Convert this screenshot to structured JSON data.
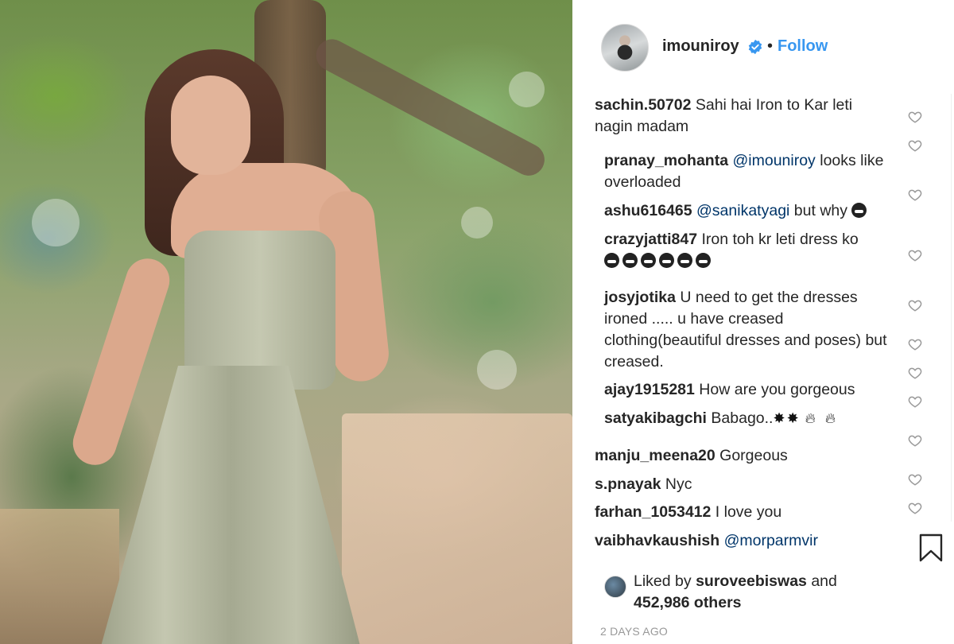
{
  "post": {
    "image_alt": "",
    "author": "imouniroy",
    "follow_label": "Follow",
    "separator": "•"
  },
  "comments": [
    {
      "user": "sachin.50702",
      "text": "Sahi hai Iron to Kar leti nagin madam"
    },
    {
      "user": "pranay_mohanta",
      "mention": "@imouniroy",
      "text": " looks like overloaded"
    },
    {
      "user": "ashu616465",
      "mention": "@sanikatyagi",
      "text": " but why"
    },
    {
      "user": "crazyjatti847",
      "text": "Iron toh kr leti dress ko"
    },
    {
      "user": "josyjotika",
      "text": "U need to get the dresses ironed ..... u have creased clothing(beautiful dresses and poses) but creased."
    },
    {
      "user": "ajay1915281",
      "text": "How are you gorgeous"
    },
    {
      "user": "satyakibagchi",
      "text": "Babago.."
    },
    {
      "user": "manju_meena20",
      "text": "Gorgeous"
    },
    {
      "user": "s.pnayak",
      "text": "Nyc"
    },
    {
      "user": "farhan_1053412",
      "text": "I love you"
    },
    {
      "user": "vaibhavkaushish",
      "mention": "@morparmvir",
      "text": ""
    }
  ],
  "likes": {
    "prefix": "Liked by",
    "user": "suroveebiswas",
    "and": "and",
    "count": "452,986 others"
  },
  "timestamp": "2 DAYS AGO",
  "icons": {
    "verified": "verified-badge-icon",
    "heart": "heart-outline-icon",
    "bookmark": "bookmark-outline-icon"
  },
  "colors": {
    "link": "#3897f0",
    "mention": "#003569",
    "text": "#262626",
    "muted": "#999999"
  }
}
